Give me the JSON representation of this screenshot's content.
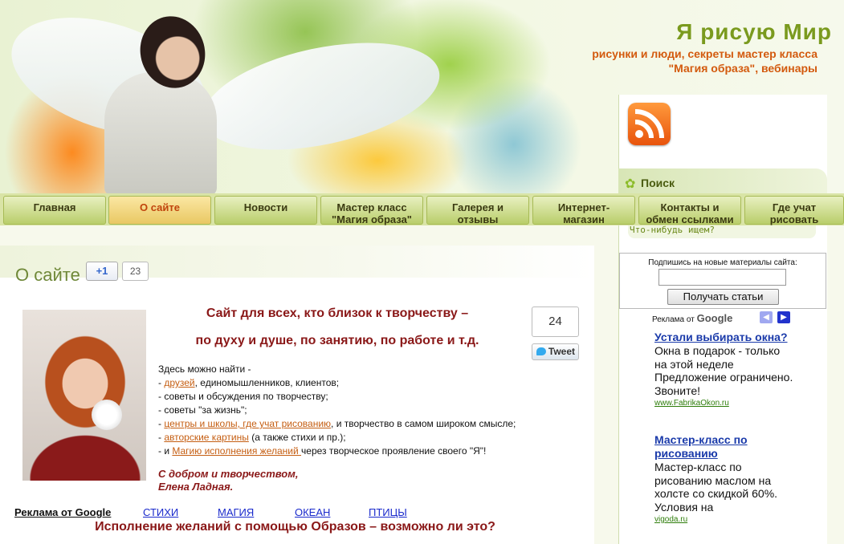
{
  "site": {
    "title": "Я рисую Мир",
    "tagline_line1": "рисунки и люди, секреты мастер класса",
    "tagline_line2": "\"Магия образа\", вебинары"
  },
  "nav": {
    "items": [
      {
        "line1": "Главная",
        "line2": "",
        "active": false
      },
      {
        "line1": "О сайте",
        "line2": "",
        "active": true
      },
      {
        "line1": "Новости",
        "line2": "",
        "active": false
      },
      {
        "line1": "Мастер класс",
        "line2": "\"Магия образа\"",
        "active": false
      },
      {
        "line1": "Галерея и",
        "line2": "отзывы",
        "active": false
      },
      {
        "line1": "Интернет-",
        "line2": "магазин",
        "active": false
      },
      {
        "line1": "Контакты и",
        "line2": "обмен ссылками",
        "active": false
      },
      {
        "line1": "Где учат",
        "line2": "рисовать",
        "active": false
      }
    ]
  },
  "sidebar": {
    "search_title": "Поиск",
    "search_placeholder": "Что-нибудь ищем?",
    "subscribe_label": "Подпишись на новые материалы сайта:",
    "subscribe_button": "Получать статьи",
    "ads_label": "Реклама от",
    "ads_logo": "Google",
    "ads": [
      {
        "title": "Устали выбирать окна?",
        "text": "Окна в подарок - только на этой неделе Предложение ограничено. Звоните!",
        "url": "www.FabrikaOkon.ru"
      },
      {
        "title": "Мастер-класс по рисованию",
        "text": "Мастер-класс по рисованию маслом на холсте со скидкой 60%. Условия на",
        "url": "vigoda.ru"
      }
    ]
  },
  "main": {
    "page_title": "О сайте",
    "gplus_label": "+1",
    "gplus_count": "23",
    "tweet_count": "24",
    "tweet_label": "Tweet",
    "headline1": "Сайт для всех, кто близок к творчеству –",
    "headline2": "по духу и душе, по занятию, по работе и т.д.",
    "intro": "Здесь можно найти -",
    "list": [
      {
        "prefix": "- ",
        "link": "друзей",
        "rest": ", единомышленников, клиентов;"
      },
      {
        "prefix": "- советы и обсуждения по творчеству;",
        "link": "",
        "rest": ""
      },
      {
        "prefix": "- советы \"за жизнь\";",
        "link": "",
        "rest": ""
      },
      {
        "prefix": "- ",
        "link": "центры и школы, где учат рисованию",
        "rest": ", и творчество в самом широком смысле;"
      },
      {
        "prefix": "- ",
        "link": "авторские картины",
        "rest": " (а также стихи и пр.);"
      },
      {
        "prefix": "- и ",
        "link": "Магию исполнения желаний ",
        "rest": "через творческое проявление своего \"Я\"!"
      }
    ],
    "signature_line1": "С добром и творчеством,",
    "signature_line2": "Елена Ладная.",
    "bottom_ads_label": "Реклама от Google",
    "bottom_topics": [
      "СТИХИ",
      "МАГИЯ",
      "ОКЕАН",
      "ПТИЦЫ"
    ],
    "article_title": "Исполнение желаний с помощью Образов – возможно ли это?"
  },
  "colors": {
    "accent_green": "#7a9a1e",
    "accent_orange": "#d35a0e",
    "headline_red": "#8a1818",
    "link_blue": "#1a3aaa"
  }
}
